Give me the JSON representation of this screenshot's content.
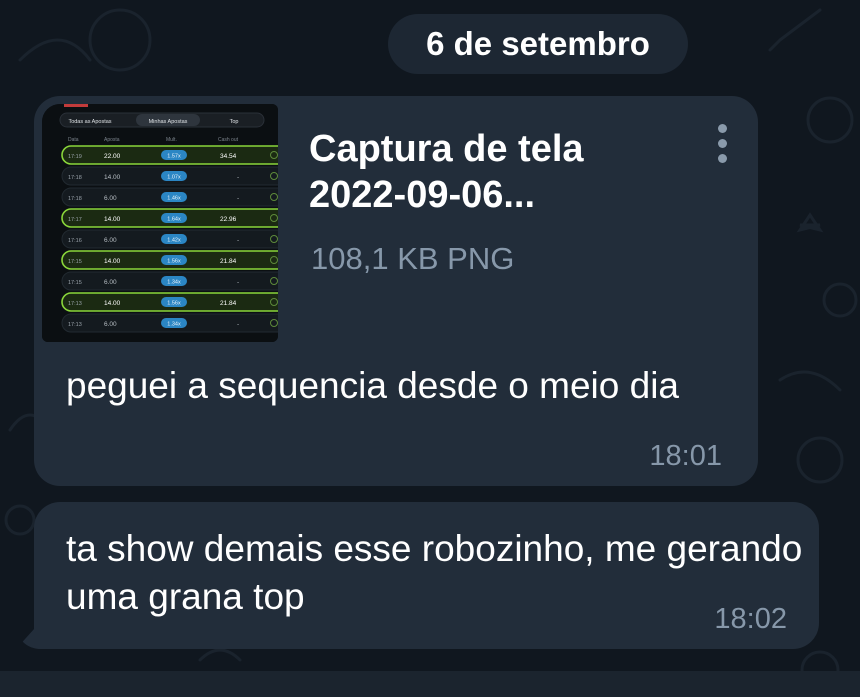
{
  "date_separator": "6 de setembro",
  "messages": [
    {
      "file": {
        "name_line1": "Captura de tela",
        "name_line2": "2022-09-06...",
        "meta": "108,1 KB PNG",
        "preview": {
          "tabs": [
            "Todas as Apostas",
            "Minhas Apostas",
            "Top"
          ],
          "headers": [
            "Data",
            "Aposta",
            "Mult.",
            "Cash out"
          ],
          "rows": [
            {
              "time": "17:19",
              "bet": "22.00",
              "mult": "1.57x",
              "cashout": "34.54",
              "win": true
            },
            {
              "time": "17:18",
              "bet": "14.00",
              "mult": "1.07x",
              "cashout": "-",
              "win": false
            },
            {
              "time": "17:18",
              "bet": "6.00",
              "mult": "1.46x",
              "cashout": "-",
              "win": false
            },
            {
              "time": "17:17",
              "bet": "14.00",
              "mult": "1.64x",
              "cashout": "22.96",
              "win": true
            },
            {
              "time": "17:16",
              "bet": "6.00",
              "mult": "1.42x",
              "cashout": "-",
              "win": false
            },
            {
              "time": "17:15",
              "bet": "14.00",
              "mult": "1.56x",
              "cashout": "21.84",
              "win": true
            },
            {
              "time": "17:15",
              "bet": "6.00",
              "mult": "1.34x",
              "cashout": "-",
              "win": false
            },
            {
              "time": "17:13",
              "bet": "14.00",
              "mult": "1.56x",
              "cashout": "21.84",
              "win": true
            },
            {
              "time": "17:13",
              "bet": "6.00",
              "mult": "1.34x",
              "cashout": "-",
              "win": false
            }
          ]
        }
      },
      "text": "peguei a sequencia desde o meio dia",
      "time": "18:01"
    },
    {
      "text": "ta show demais esse robozinho, me gerando uma grana top",
      "time": "18:02"
    }
  ],
  "colors": {
    "background": "#10171f",
    "bubble": "#222d3a",
    "meta_text": "#8798aa",
    "win_row": "#8ad63a",
    "mult_badge": "#2b86c4"
  },
  "icons": [
    "more-vert-icon",
    "check-icon"
  ]
}
